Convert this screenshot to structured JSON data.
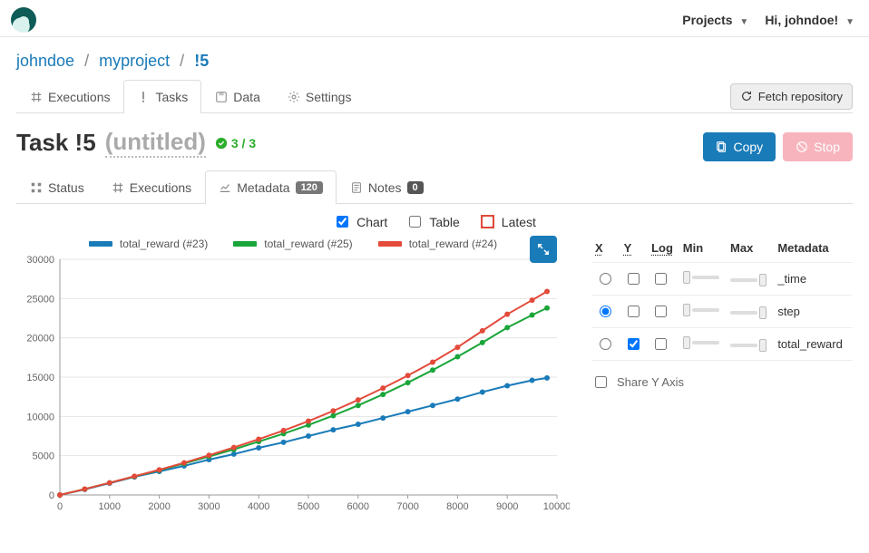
{
  "top": {
    "menu": {
      "projects": "Projects",
      "greeting": "Hi, johndoe!"
    }
  },
  "breadcrumb": {
    "user": "johndoe",
    "project": "myproject",
    "task": "!5"
  },
  "main_tabs": {
    "executions": "Executions",
    "tasks": "Tasks",
    "data": "Data",
    "settings": "Settings",
    "fetch": "Fetch repository"
  },
  "title": {
    "prefix": "Task !5",
    "subtitle": "(untitled)",
    "status": "3 / 3"
  },
  "actions": {
    "copy": "Copy",
    "stop": "Stop"
  },
  "sub_tabs": {
    "status": "Status",
    "executions": "Executions",
    "metadata": "Metadata",
    "metadata_count": "120",
    "notes": "Notes",
    "notes_count": "0"
  },
  "view_opts": {
    "chart": "Chart",
    "table": "Table",
    "latest": "Latest"
  },
  "view_state": {
    "chart": true,
    "table": false,
    "latest": false
  },
  "side": {
    "headers": {
      "x": "X",
      "y": "Y",
      "log": "Log",
      "min": "Min",
      "max": "Max",
      "metadata": "Metadata"
    },
    "rows": [
      {
        "name": "_time",
        "x": false,
        "y": false,
        "log": false
      },
      {
        "name": "step",
        "x": true,
        "y": false,
        "log": false
      },
      {
        "name": "total_reward",
        "x": false,
        "y": true,
        "log": false
      }
    ],
    "share": "Share Y Axis",
    "share_checked": false
  },
  "chart_data": {
    "type": "line",
    "title": "",
    "xlabel": "",
    "ylabel": "",
    "xlim": [
      0,
      10000
    ],
    "ylim": [
      0,
      30000
    ],
    "xticks": [
      0,
      1000,
      2000,
      3000,
      4000,
      5000,
      6000,
      7000,
      8000,
      9000,
      10000
    ],
    "yticks": [
      0,
      5000,
      10000,
      15000,
      20000,
      25000,
      30000
    ],
    "x": [
      0,
      500,
      1000,
      1500,
      2000,
      2500,
      3000,
      3500,
      4000,
      4500,
      5000,
      5500,
      6000,
      6500,
      7000,
      7500,
      8000,
      8500,
      9000,
      9500,
      9800
    ],
    "series": [
      {
        "name": "total_reward (#23)",
        "color": "#1a7bb9",
        "values": [
          0,
          700,
          1500,
          2300,
          3000,
          3700,
          4500,
          5200,
          6000,
          6700,
          7500,
          8300,
          9000,
          9800,
          10600,
          11400,
          12200,
          13100,
          13900,
          14600,
          14900
        ]
      },
      {
        "name": "total_reward (#25)",
        "color": "#1aa53a",
        "values": [
          0,
          750,
          1550,
          2350,
          3150,
          4000,
          4900,
          5800,
          6800,
          7800,
          8900,
          10100,
          11400,
          12800,
          14300,
          15900,
          17600,
          19400,
          21300,
          22900,
          23800
        ]
      },
      {
        "name": "total_reward (#24)",
        "color": "#e34a3a",
        "values": [
          0,
          750,
          1550,
          2380,
          3200,
          4100,
          5050,
          6050,
          7100,
          8200,
          9400,
          10700,
          12100,
          13600,
          15200,
          16900,
          18800,
          20900,
          23000,
          24800,
          25900
        ]
      }
    ],
    "legend_position": "top"
  }
}
